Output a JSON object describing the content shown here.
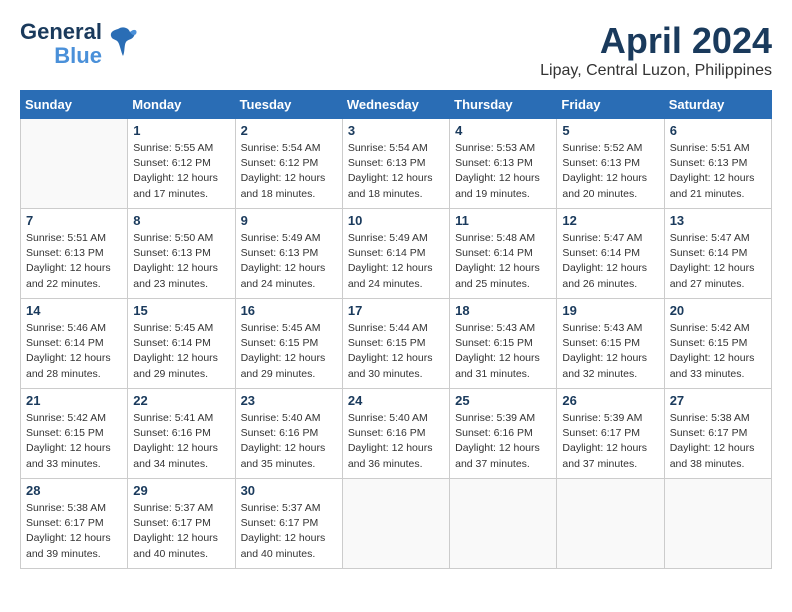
{
  "app": {
    "logo_line1": "General",
    "logo_line2": "Blue"
  },
  "header": {
    "month": "April 2024",
    "location": "Lipay, Central Luzon, Philippines"
  },
  "calendar": {
    "days_of_week": [
      "Sunday",
      "Monday",
      "Tuesday",
      "Wednesday",
      "Thursday",
      "Friday",
      "Saturday"
    ],
    "weeks": [
      [
        {
          "day": "",
          "info": ""
        },
        {
          "day": "1",
          "info": "Sunrise: 5:55 AM\nSunset: 6:12 PM\nDaylight: 12 hours\nand 17 minutes."
        },
        {
          "day": "2",
          "info": "Sunrise: 5:54 AM\nSunset: 6:12 PM\nDaylight: 12 hours\nand 18 minutes."
        },
        {
          "day": "3",
          "info": "Sunrise: 5:54 AM\nSunset: 6:13 PM\nDaylight: 12 hours\nand 18 minutes."
        },
        {
          "day": "4",
          "info": "Sunrise: 5:53 AM\nSunset: 6:13 PM\nDaylight: 12 hours\nand 19 minutes."
        },
        {
          "day": "5",
          "info": "Sunrise: 5:52 AM\nSunset: 6:13 PM\nDaylight: 12 hours\nand 20 minutes."
        },
        {
          "day": "6",
          "info": "Sunrise: 5:51 AM\nSunset: 6:13 PM\nDaylight: 12 hours\nand 21 minutes."
        }
      ],
      [
        {
          "day": "7",
          "info": "Sunrise: 5:51 AM\nSunset: 6:13 PM\nDaylight: 12 hours\nand 22 minutes."
        },
        {
          "day": "8",
          "info": "Sunrise: 5:50 AM\nSunset: 6:13 PM\nDaylight: 12 hours\nand 23 minutes."
        },
        {
          "day": "9",
          "info": "Sunrise: 5:49 AM\nSunset: 6:13 PM\nDaylight: 12 hours\nand 24 minutes."
        },
        {
          "day": "10",
          "info": "Sunrise: 5:49 AM\nSunset: 6:14 PM\nDaylight: 12 hours\nand 24 minutes."
        },
        {
          "day": "11",
          "info": "Sunrise: 5:48 AM\nSunset: 6:14 PM\nDaylight: 12 hours\nand 25 minutes."
        },
        {
          "day": "12",
          "info": "Sunrise: 5:47 AM\nSunset: 6:14 PM\nDaylight: 12 hours\nand 26 minutes."
        },
        {
          "day": "13",
          "info": "Sunrise: 5:47 AM\nSunset: 6:14 PM\nDaylight: 12 hours\nand 27 minutes."
        }
      ],
      [
        {
          "day": "14",
          "info": "Sunrise: 5:46 AM\nSunset: 6:14 PM\nDaylight: 12 hours\nand 28 minutes."
        },
        {
          "day": "15",
          "info": "Sunrise: 5:45 AM\nSunset: 6:14 PM\nDaylight: 12 hours\nand 29 minutes."
        },
        {
          "day": "16",
          "info": "Sunrise: 5:45 AM\nSunset: 6:15 PM\nDaylight: 12 hours\nand 29 minutes."
        },
        {
          "day": "17",
          "info": "Sunrise: 5:44 AM\nSunset: 6:15 PM\nDaylight: 12 hours\nand 30 minutes."
        },
        {
          "day": "18",
          "info": "Sunrise: 5:43 AM\nSunset: 6:15 PM\nDaylight: 12 hours\nand 31 minutes."
        },
        {
          "day": "19",
          "info": "Sunrise: 5:43 AM\nSunset: 6:15 PM\nDaylight: 12 hours\nand 32 minutes."
        },
        {
          "day": "20",
          "info": "Sunrise: 5:42 AM\nSunset: 6:15 PM\nDaylight: 12 hours\nand 33 minutes."
        }
      ],
      [
        {
          "day": "21",
          "info": "Sunrise: 5:42 AM\nSunset: 6:15 PM\nDaylight: 12 hours\nand 33 minutes."
        },
        {
          "day": "22",
          "info": "Sunrise: 5:41 AM\nSunset: 6:16 PM\nDaylight: 12 hours\nand 34 minutes."
        },
        {
          "day": "23",
          "info": "Sunrise: 5:40 AM\nSunset: 6:16 PM\nDaylight: 12 hours\nand 35 minutes."
        },
        {
          "day": "24",
          "info": "Sunrise: 5:40 AM\nSunset: 6:16 PM\nDaylight: 12 hours\nand 36 minutes."
        },
        {
          "day": "25",
          "info": "Sunrise: 5:39 AM\nSunset: 6:16 PM\nDaylight: 12 hours\nand 37 minutes."
        },
        {
          "day": "26",
          "info": "Sunrise: 5:39 AM\nSunset: 6:17 PM\nDaylight: 12 hours\nand 37 minutes."
        },
        {
          "day": "27",
          "info": "Sunrise: 5:38 AM\nSunset: 6:17 PM\nDaylight: 12 hours\nand 38 minutes."
        }
      ],
      [
        {
          "day": "28",
          "info": "Sunrise: 5:38 AM\nSunset: 6:17 PM\nDaylight: 12 hours\nand 39 minutes."
        },
        {
          "day": "29",
          "info": "Sunrise: 5:37 AM\nSunset: 6:17 PM\nDaylight: 12 hours\nand 40 minutes."
        },
        {
          "day": "30",
          "info": "Sunrise: 5:37 AM\nSunset: 6:17 PM\nDaylight: 12 hours\nand 40 minutes."
        },
        {
          "day": "",
          "info": ""
        },
        {
          "day": "",
          "info": ""
        },
        {
          "day": "",
          "info": ""
        },
        {
          "day": "",
          "info": ""
        }
      ]
    ]
  }
}
